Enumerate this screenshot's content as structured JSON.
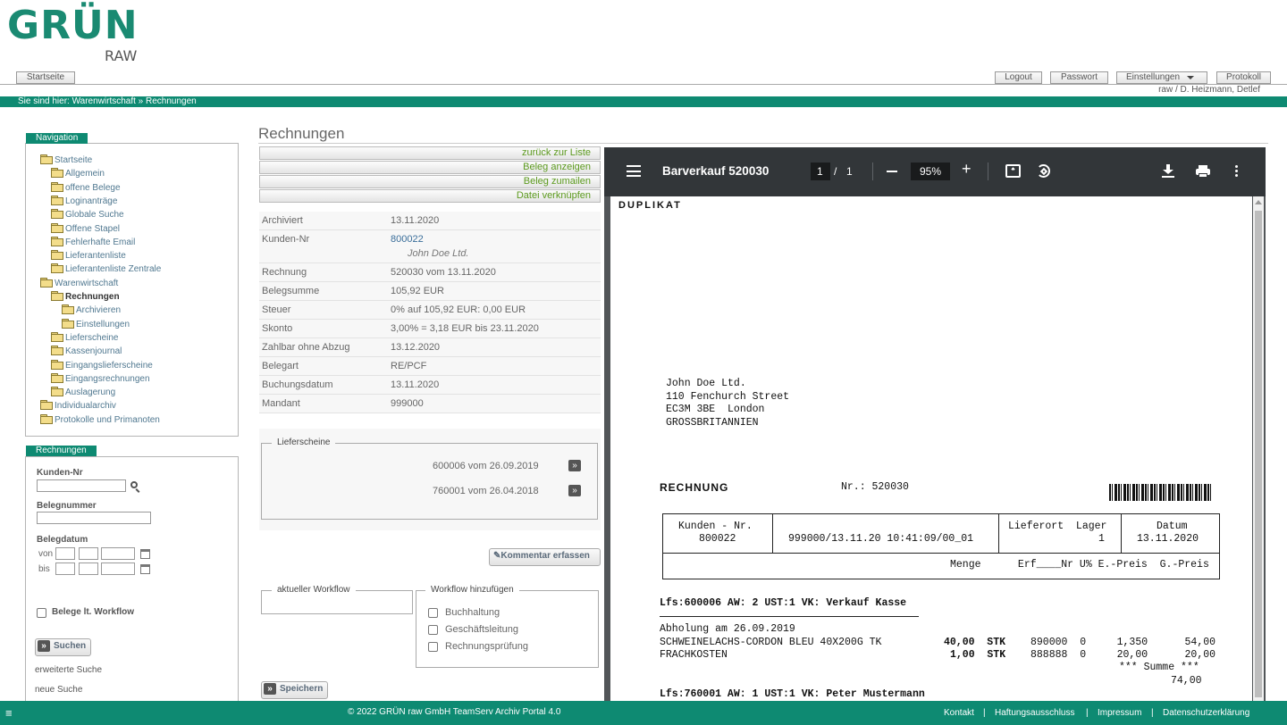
{
  "logo": {
    "main": "GRÜN",
    "sub": "RAW"
  },
  "topnav": {
    "home": "Startseite",
    "logout": "Logout",
    "password": "Passwort",
    "settings": "Einstellungen",
    "protocol": "Protokoll",
    "user": "raw / D. Heizmann, Detlef"
  },
  "breadcrumb": "Sie sind hier: Warenwirtschaft » Rechnungen",
  "navigation": {
    "title": "Navigation",
    "items": [
      {
        "label": "Startseite"
      },
      {
        "label": "Allgemein"
      },
      {
        "label": "offene Belege"
      },
      {
        "label": "Loginanträge"
      },
      {
        "label": "Globale Suche"
      },
      {
        "label": "Offene Stapel"
      },
      {
        "label": "Fehlerhafte Email"
      },
      {
        "label": "Lieferantenliste"
      },
      {
        "label": "Lieferantenliste Zentrale"
      },
      {
        "label": "Warenwirtschaft"
      },
      {
        "label": "Rechnungen"
      },
      {
        "label": "Archivieren"
      },
      {
        "label": "Einstellungen"
      },
      {
        "label": "Lieferscheine"
      },
      {
        "label": "Kassenjournal"
      },
      {
        "label": "Eingangslieferscheine"
      },
      {
        "label": "Eingangsrechnungen"
      },
      {
        "label": "Auslagerung"
      },
      {
        "label": "Individualarchiv"
      },
      {
        "label": "Protokolle und Primanoten"
      }
    ]
  },
  "search": {
    "title": "Rechnungen",
    "customer_label": "Kunden-Nr",
    "doc_label": "Belegnummer",
    "date_label": "Belegdatum",
    "from": "von",
    "to": "bis",
    "workflow_label": "Belege lt. Workflow",
    "search_btn": "Suchen",
    "advanced": "erweiterte Suche",
    "new": "neue Suche"
  },
  "main": {
    "title": "Rechnungen",
    "actions": [
      "zurück zur Liste",
      "Beleg anzeigen",
      "Beleg zumailen",
      "Datei verknüpfen"
    ],
    "details": [
      {
        "k": "Archiviert",
        "v": "13.11.2020"
      },
      {
        "k": "Kunden-Nr",
        "v": "800022",
        "sub": "John Doe Ltd."
      },
      {
        "k": "Rechnung",
        "v": "520030 vom 13.11.2020"
      },
      {
        "k": "Belegsumme",
        "v": "105,92 EUR"
      },
      {
        "k": "Steuer",
        "v": "0% auf 105,92 EUR:    0,00 EUR"
      },
      {
        "k": "Skonto",
        "v": "3,00% = 3,18 EUR bis 23.11.2020"
      },
      {
        "k": "Zahlbar ohne Abzug",
        "v": "13.12.2020"
      },
      {
        "k": "Belegart",
        "v": "RE/PCF"
      },
      {
        "k": "Buchungsdatum",
        "v": "13.11.2020"
      },
      {
        "k": "Mandant",
        "v": "999000"
      }
    ],
    "delivery_title": "Lieferscheine",
    "deliveries": [
      "600006 vom 26.09.2019",
      "760001 vom 26.04.2018"
    ],
    "comment_btn": "Kommentar erfassen",
    "workflow_current": "aktueller Workflow",
    "workflow_add": "Workflow hinzufügen",
    "workflow_options": [
      "Buchhaltung",
      "Geschäftsleitung",
      "Rechnungsprüfung"
    ],
    "save_btn": "Speichern"
  },
  "pdf": {
    "title": "Barverkauf 520030",
    "page": "1",
    "pages": "1",
    "zoom": "95%",
    "duplicate": "DUPLIKAT",
    "address": "John Doe Ltd.\n110 Fenchurch Street\nEC3M 3BE  London\nGROSSBRITANNIEN",
    "doc_type": "RECHNUNG",
    "doc_nr": "Nr.: 520030",
    "h_customer": "Kunden - Nr.",
    "v_customer": "800022",
    "v_ref": "999000/13.11.20 10:41:09/00_01",
    "h_place": "Lieferort  Lager",
    "v_place": "1",
    "h_date": "Datum",
    "v_date": "13.11.2020",
    "cols": "Menge      Erf____Nr U% E.-Preis  G.-Preis",
    "lfs1": "Lfs:600006 AW: 2 UST:1 VK: Verkauf Kasse",
    "pickup": "Abholung am 26.09.2019",
    "item1_name": "SCHWEINELACHS-CORDON BLEU 40X200G TK",
    "item1_qty": "40,00  STK",
    "item1_rest": "890000  0     1,350      54,00",
    "item2_name": "FRACHKOSTEN",
    "item2_qty": "1,00  STK",
    "item2_rest": "888888  0     20,00      20,00",
    "sum_label": "*** Summe ***",
    "sum_value": "74,00",
    "lfs2": "Lfs:760001 AW: 1 UST:1 VK: Peter Mustermann"
  },
  "footer": {
    "copyright": "© 2022 GRÜN raw GmbH TeamServ Archiv Portal 4.0",
    "links": [
      "Kontakt",
      "Haftungsausschluss",
      "Impressum",
      "Datenschutzerklärung"
    ]
  },
  "colors": {
    "brand": "#0e8a72",
    "link": "#5c9a1e",
    "pdf_toolbar": "#323639"
  }
}
